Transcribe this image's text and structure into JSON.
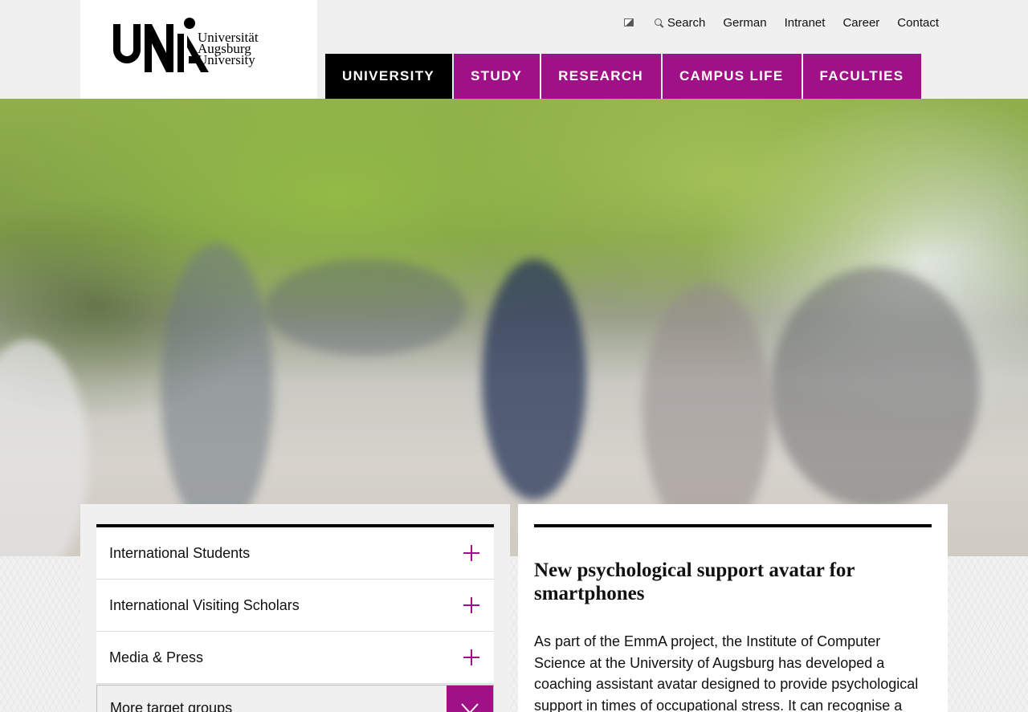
{
  "logo": {
    "line1": "Universität",
    "line2": "Augsburg",
    "line3": "University"
  },
  "utility_nav": {
    "contrast_icon": "contrast-icon",
    "search_label": "Search",
    "language_label": "German",
    "intranet_label": "Intranet",
    "career_label": "Career",
    "contact_label": "Contact"
  },
  "main_nav": {
    "items": [
      {
        "label": "UNIVERSITY",
        "active": true
      },
      {
        "label": "STUDY"
      },
      {
        "label": "RESEARCH"
      },
      {
        "label": "CAMPUS LIFE"
      },
      {
        "label": "FACULTIES"
      }
    ]
  },
  "target_groups": {
    "items": [
      {
        "label": "International Students"
      },
      {
        "label": "International Visiting Scholars"
      },
      {
        "label": "Media & Press"
      }
    ],
    "more_label": "More target groups"
  },
  "news": {
    "title": "New psychological support avatar for smartphones",
    "body": "As part of the EmmA project, the Institute of Computer Science at the University of Augsburg has developed a coaching assistant avatar designed to provide psychological support in times of occupational stress. It can recognise a user’s"
  },
  "colors": {
    "brand": "#a01187",
    "active_nav": "#000000",
    "header_bg": "#f0f0f0"
  }
}
